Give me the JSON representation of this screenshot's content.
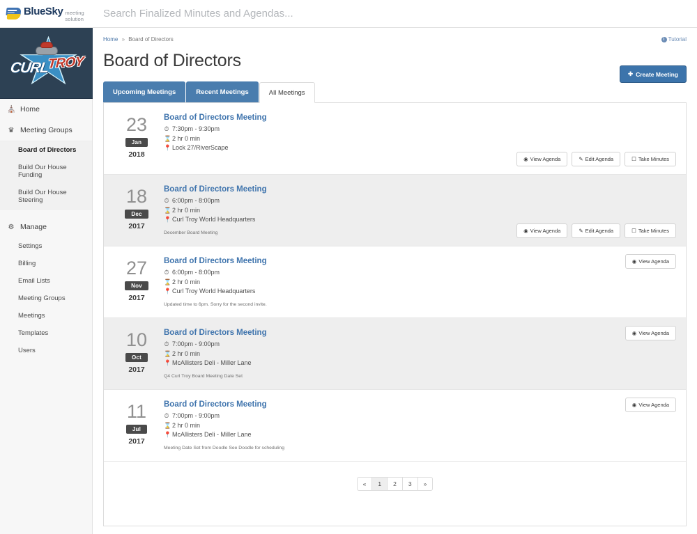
{
  "brand": {
    "name_blue": "Blue",
    "name_sky": "Sky",
    "tagline": "meeting solution",
    "logo_icon": "bluesky-swoosh-icon"
  },
  "search": {
    "placeholder": "Search Finalized Minutes and Agendas...",
    "value": ""
  },
  "sidebar": {
    "org_logo": {
      "primary_word": "CURL",
      "secondary_word": "TROY",
      "icon": "curling-stone-star-icon"
    },
    "home": {
      "label": "Home",
      "icon": "home-icon"
    },
    "meeting_groups": {
      "label": "Meeting Groups",
      "icon": "group-icon",
      "items": [
        {
          "label": "Board of Directors",
          "active": true
        },
        {
          "label": "Build Our House Funding",
          "active": false
        },
        {
          "label": "Build Our House Steering",
          "active": false
        }
      ]
    },
    "manage": {
      "label": "Manage",
      "icon": "gear-icon",
      "items": [
        {
          "label": "Settings"
        },
        {
          "label": "Billing"
        },
        {
          "label": "Email Lists"
        },
        {
          "label": "Meeting Groups"
        },
        {
          "label": "Meetings"
        },
        {
          "label": "Templates"
        },
        {
          "label": "Users"
        }
      ]
    }
  },
  "breadcrumb": {
    "home": "Home",
    "separator": "»",
    "current": "Board of Directors"
  },
  "tutorial": {
    "label": "Tutorial",
    "icon": "info-circle-icon"
  },
  "page": {
    "title": "Board of Directors"
  },
  "tabs": [
    {
      "label": "Upcoming Meetings",
      "active": false
    },
    {
      "label": "Recent Meetings",
      "active": false
    },
    {
      "label": "All Meetings",
      "active": true
    }
  ],
  "create_button": {
    "label": "Create Meeting",
    "icon": "plus-icon"
  },
  "action_labels": {
    "view_agenda": "View Agenda",
    "edit_agenda": "Edit Agenda",
    "take_minutes": "Take Minutes"
  },
  "meetings": [
    {
      "day": "23",
      "month": "Jan",
      "year": "2018",
      "title": "Board of Directors Meeting",
      "time": "7:30pm - 9:30pm",
      "duration": "2 hr 0 min",
      "location": "Lock 27/RiverScape",
      "note": "",
      "actions": [
        "View Agenda",
        "Edit Agenda",
        "Take Minutes"
      ],
      "actions_position": "bottom",
      "shaded": false
    },
    {
      "day": "18",
      "month": "Dec",
      "year": "2017",
      "title": "Board of Directors Meeting",
      "time": "6:00pm - 8:00pm",
      "duration": "2 hr 0 min",
      "location": "Curl Troy World Headquarters",
      "note": "December Board Meeting",
      "actions": [
        "View Agenda",
        "Edit Agenda",
        "Take Minutes"
      ],
      "actions_position": "bottom",
      "shaded": true
    },
    {
      "day": "27",
      "month": "Nov",
      "year": "2017",
      "title": "Board of Directors Meeting",
      "time": "6:00pm - 8:00pm",
      "duration": "2 hr 0 min",
      "location": "Curl Troy World Headquarters",
      "note": "Updated time to 6pm. Sorry for the second invite.",
      "actions": [
        "View Agenda"
      ],
      "actions_position": "top",
      "shaded": false
    },
    {
      "day": "10",
      "month": "Oct",
      "year": "2017",
      "title": "Board of Directors Meeting",
      "time": "7:00pm - 9:00pm",
      "duration": "2 hr 0 min",
      "location": "McAllisters Deli - Miller Lane",
      "note": "Q4 Curl Troy Board Meeting Date Set",
      "actions": [
        "View Agenda"
      ],
      "actions_position": "top",
      "shaded": true
    },
    {
      "day": "11",
      "month": "Jul",
      "year": "2017",
      "title": "Board of Directors Meeting",
      "time": "7:00pm - 9:00pm",
      "duration": "2 hr 0 min",
      "location": "McAllisters Deli - Miller Lane",
      "note": "Meeting Date Set from Doodle See Doodle for scheduling",
      "actions": [
        "View Agenda"
      ],
      "actions_position": "top",
      "shaded": false
    }
  ],
  "pagination": {
    "prev": "«",
    "next": "»",
    "pages": [
      "1",
      "2",
      "3"
    ],
    "active_page": "1"
  },
  "colors": {
    "brand_blue": "#3f74ad",
    "tab_blue": "#4a7dae",
    "create_blue": "#3c74ab",
    "sidebar_navy": "#2d4154",
    "row_shade": "#eeeeee"
  },
  "icons": {
    "clock": "◔",
    "hourglass": "⌛",
    "pin": "⚑",
    "eye": "◉",
    "pencil": "✎",
    "checkbox": "☐",
    "plus": "✚"
  }
}
